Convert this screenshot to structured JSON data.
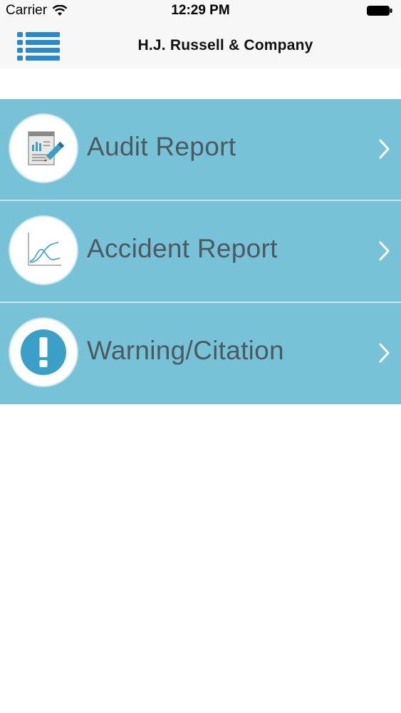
{
  "status_bar": {
    "carrier": "Carrier",
    "time": "12:29 PM",
    "wifi_icon": "wifi-icon",
    "battery_icon": "battery-icon"
  },
  "nav_bar": {
    "title": "H.J. Russell & Company",
    "menu_icon": "hamburger-list-icon",
    "accent_color": "#2a88cf"
  },
  "menu": {
    "background_color": "#78c2d7",
    "items": [
      {
        "label": "Audit Report",
        "icon": "report-document-icon"
      },
      {
        "label": "Accident Report",
        "icon": "line-chart-icon"
      },
      {
        "label": "Warning/Citation",
        "icon": "exclamation-icon"
      }
    ]
  }
}
